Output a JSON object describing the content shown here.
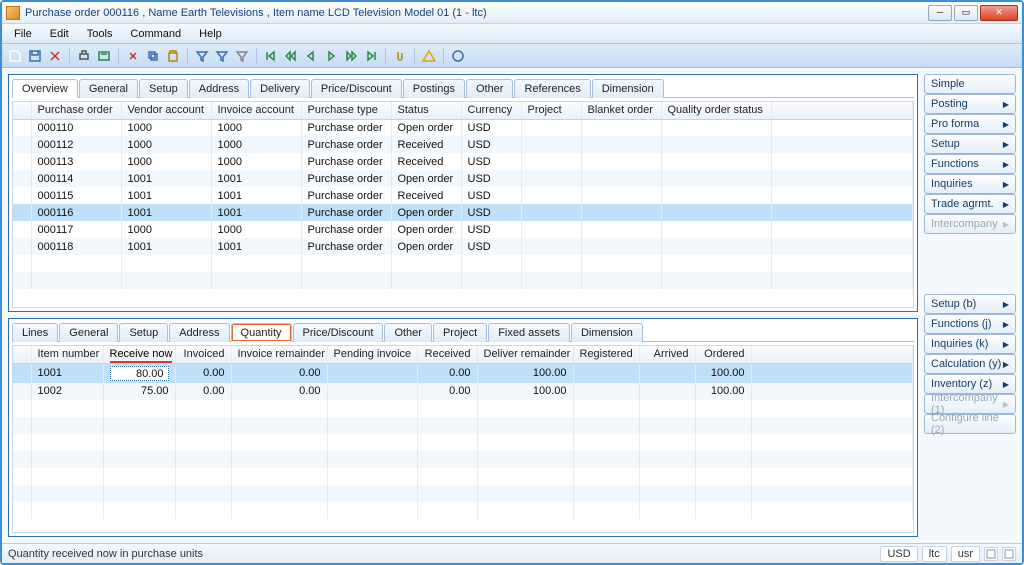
{
  "window": {
    "title": "Purchase order 000116 , Name Earth Televisions , Item name LCD Television Model 01 (1 - ltc)"
  },
  "menus": [
    "File",
    "Edit",
    "Tools",
    "Command",
    "Help"
  ],
  "topTabs": [
    "Overview",
    "General",
    "Setup",
    "Address",
    "Delivery",
    "Price/Discount",
    "Postings",
    "Other",
    "References",
    "Dimension"
  ],
  "topActiveTab": 0,
  "topGrid": {
    "columns": [
      "Purchase order",
      "Vendor account",
      "Invoice account",
      "Purchase type",
      "Status",
      "Currency",
      "Project",
      "Blanket order",
      "Quality order status"
    ],
    "rows": [
      {
        "po": "000110",
        "va": "1000",
        "ia": "1000",
        "pt": "Purchase order",
        "st": "Open order",
        "cu": "USD",
        "pr": "",
        "bl": "",
        "qo": ""
      },
      {
        "po": "000112",
        "va": "1000",
        "ia": "1000",
        "pt": "Purchase order",
        "st": "Received",
        "cu": "USD",
        "pr": "",
        "bl": "",
        "qo": ""
      },
      {
        "po": "000113",
        "va": "1000",
        "ia": "1000",
        "pt": "Purchase order",
        "st": "Received",
        "cu": "USD",
        "pr": "",
        "bl": "",
        "qo": ""
      },
      {
        "po": "000114",
        "va": "1001",
        "ia": "1001",
        "pt": "Purchase order",
        "st": "Open order",
        "cu": "USD",
        "pr": "",
        "bl": "",
        "qo": ""
      },
      {
        "po": "000115",
        "va": "1001",
        "ia": "1001",
        "pt": "Purchase order",
        "st": "Received",
        "cu": "USD",
        "pr": "",
        "bl": "",
        "qo": ""
      },
      {
        "po": "000116",
        "va": "1001",
        "ia": "1001",
        "pt": "Purchase order",
        "st": "Open order",
        "cu": "USD",
        "pr": "",
        "bl": "",
        "qo": ""
      },
      {
        "po": "000117",
        "va": "1000",
        "ia": "1000",
        "pt": "Purchase order",
        "st": "Open order",
        "cu": "USD",
        "pr": "",
        "bl": "",
        "qo": ""
      },
      {
        "po": "000118",
        "va": "1001",
        "ia": "1001",
        "pt": "Purchase order",
        "st": "Open order",
        "cu": "USD",
        "pr": "",
        "bl": "",
        "qo": ""
      }
    ],
    "selectedIndex": 5
  },
  "botTabs": [
    "Lines",
    "General",
    "Setup",
    "Address",
    "Quantity",
    "Price/Discount",
    "Other",
    "Project",
    "Fixed assets",
    "Dimension"
  ],
  "botActiveTab": 4,
  "botGrid": {
    "columns": [
      "Item number",
      "Receive now",
      "Invoiced",
      "Invoice remainder",
      "Pending invoice",
      "Received",
      "Deliver remainder",
      "Registered",
      "Arrived",
      "Ordered"
    ],
    "rows": [
      {
        "item": "1001",
        "rn": "80.00",
        "inv": "0.00",
        "ir": "0.00",
        "pi": "",
        "rc": "0.00",
        "dr": "100.00",
        "rg": "",
        "ar": "",
        "ord": "100.00"
      },
      {
        "item": "1002",
        "rn": "75.00",
        "inv": "0.00",
        "ir": "0.00",
        "pi": "",
        "rc": "0.00",
        "dr": "100.00",
        "rg": "",
        "ar": "",
        "ord": "100.00"
      }
    ],
    "highlightCol": "Receive now",
    "selectedIndex": 0
  },
  "actionsTop": [
    {
      "label": "Simple",
      "caret": false,
      "disabled": false
    },
    {
      "label": "Posting",
      "caret": true,
      "disabled": false
    },
    {
      "label": "Pro forma",
      "caret": true,
      "disabled": false
    },
    {
      "label": "Setup",
      "caret": true,
      "disabled": false
    },
    {
      "label": "Functions",
      "caret": true,
      "disabled": false
    },
    {
      "label": "Inquiries",
      "caret": true,
      "disabled": false
    },
    {
      "label": "Trade agrmt.",
      "caret": true,
      "disabled": false
    },
    {
      "label": "Intercompany",
      "caret": true,
      "disabled": true
    }
  ],
  "actionsBot": [
    {
      "label": "Setup (b)",
      "caret": true,
      "disabled": false
    },
    {
      "label": "Functions (j)",
      "caret": true,
      "disabled": false
    },
    {
      "label": "Inquiries (k)",
      "caret": true,
      "disabled": false
    },
    {
      "label": "Calculation (y)",
      "caret": true,
      "disabled": false
    },
    {
      "label": "Inventory (z)",
      "caret": true,
      "disabled": false
    },
    {
      "label": "Intercompany (1)",
      "caret": true,
      "disabled": true
    },
    {
      "label": "Configure line (2)",
      "caret": false,
      "disabled": true
    }
  ],
  "status": {
    "left": "Quantity received now in purchase units",
    "segments": [
      "USD",
      "ltc",
      "usr"
    ]
  },
  "toolbarIcons": [
    "new",
    "save",
    "delete",
    "sep",
    "print",
    "preview",
    "sep",
    "cut",
    "copy",
    "paste",
    "sep",
    "filter",
    "filter-by",
    "clear-filter",
    "sep",
    "first",
    "prev-fast",
    "prev",
    "next",
    "next-fast",
    "last",
    "sep",
    "attach",
    "sep",
    "warn",
    "sep",
    "help"
  ]
}
